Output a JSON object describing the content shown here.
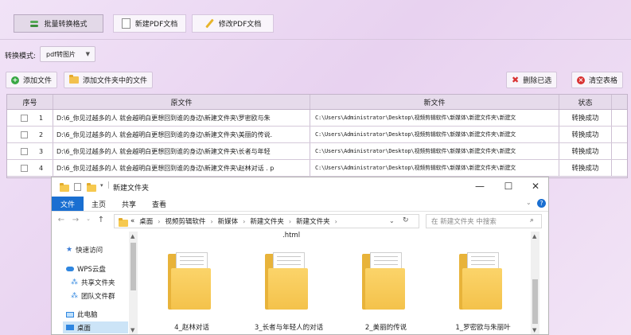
{
  "toolbar": {
    "tabs": [
      {
        "label": "批量转换格式",
        "icon": "convert-icon",
        "active": true
      },
      {
        "label": "新建PDF文档",
        "icon": "document-icon",
        "active": false
      },
      {
        "label": "修改PDF文档",
        "icon": "pencil-icon",
        "active": false
      }
    ]
  },
  "mode": {
    "label": "转换模式:",
    "selected": "pdf转图片"
  },
  "actions": {
    "add_file": "添加文件",
    "add_folder": "添加文件夹中的文件",
    "delete_selected": "删除已选",
    "clear_table": "清空表格"
  },
  "table": {
    "headers": [
      "序号",
      "原文件",
      "新文件",
      "状态"
    ],
    "rows": [
      {
        "index": "1",
        "original": "D:\\6_你见过越多的人 就会越明白更想回到谁的身边\\新建文件夹\\罗密欧与朱",
        "new": "C:\\Users\\Administrator\\Desktop\\视频剪辑软件\\新媒体\\新建文件夹\\新建文",
        "status": "转换成功"
      },
      {
        "index": "2",
        "original": "D:\\6_你见过越多的人 就会越明白更想回到谁的身边\\新建文件夹\\美丽的传说.",
        "new": "C:\\Users\\Administrator\\Desktop\\视频剪辑软件\\新媒体\\新建文件夹\\新建文",
        "status": "转换成功"
      },
      {
        "index": "3",
        "original": "D:\\6_你见过越多的人 就会越明白更想回到谁的身边\\新建文件夹\\长者与年轻",
        "new": "C:\\Users\\Administrator\\Desktop\\视频剪辑软件\\新媒体\\新建文件夹\\新建文",
        "status": "转换成功"
      },
      {
        "index": "4",
        "original": "D:\\6_你见过越多的人  就会越明白更想回到谁的身边\\新建文件夹\\赵林对话 . p",
        "new": "C:\\Users\\Administrator\\Desktop\\视频剪辑软件\\新媒体\\新建文件夹\\新建文",
        "status": "转换成功"
      }
    ]
  },
  "explorer": {
    "title": "新建文件夹",
    "window_controls": {
      "minimize": "—",
      "maximize": "☐",
      "close": "✕"
    },
    "ribbon_tabs": [
      "文件",
      "主页",
      "共享",
      "查看"
    ],
    "address": {
      "prefix": "«",
      "parts": [
        "桌面",
        "视频剪辑软件",
        "新媒体",
        "新建文件夹",
        "新建文件夹"
      ]
    },
    "search_placeholder": "在 新建文件夹 中搜索",
    "nav_items": [
      "快速访问",
      "WPS云盘",
      "共享文件夹",
      "团队文件群",
      "此电脑",
      "桌面"
    ],
    "top_item_label": ".html",
    "folders": [
      "4_赵林对话",
      "3_长者与年轻人的对话",
      "2_美丽的传说",
      "1_罗密欧与朱丽叶"
    ]
  },
  "colors": {
    "accent_blue": "#1a6fd1",
    "success_green": "#39a845",
    "danger_red": "#d93232",
    "folder_yellow": "#f4c24b"
  }
}
